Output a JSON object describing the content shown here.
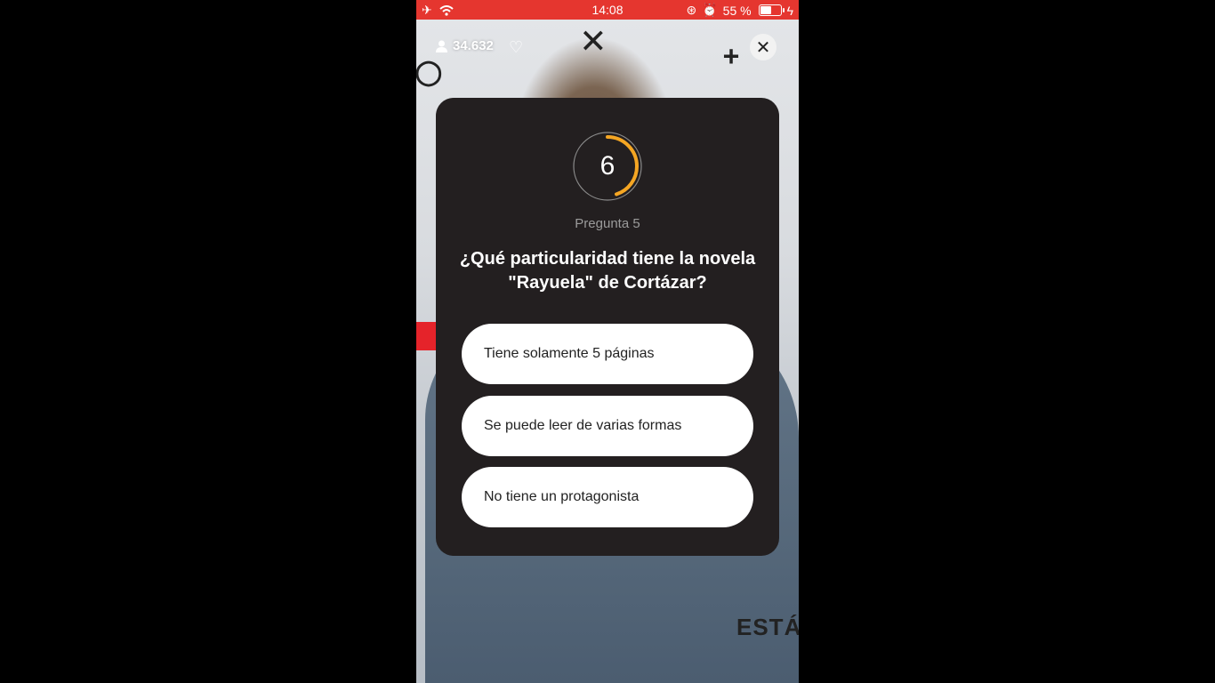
{
  "status_bar": {
    "time": "14:08",
    "battery_text": "55 %",
    "battery_level": 0.55,
    "icons": [
      "airplane-icon",
      "wifi-icon",
      "orientation-lock-icon",
      "alarm-icon",
      "battery-icon",
      "charging-icon"
    ]
  },
  "live": {
    "viewer_count": "34.632",
    "viewer_icon": "person-icon",
    "like_icon": "heart-outline-icon",
    "close_icon": "close-icon"
  },
  "quiz": {
    "timer_value": "6",
    "timer_progress": 0.45,
    "timer_color": "#f5a623",
    "question_label": "Pregunta 5",
    "question_line1": "¿Qué particularidad tiene la novela",
    "question_line2": "\"Rayuela\" de Cortázar?",
    "answers": [
      {
        "label": "Tiene solamente 5 páginas"
      },
      {
        "label": "Se puede leer de varias formas"
      },
      {
        "label": "No tiene un protagonista"
      }
    ]
  },
  "background": {
    "caption": "ESTÁ"
  },
  "colors": {
    "status_bar": "#e5362f",
    "card": "#231f20"
  }
}
